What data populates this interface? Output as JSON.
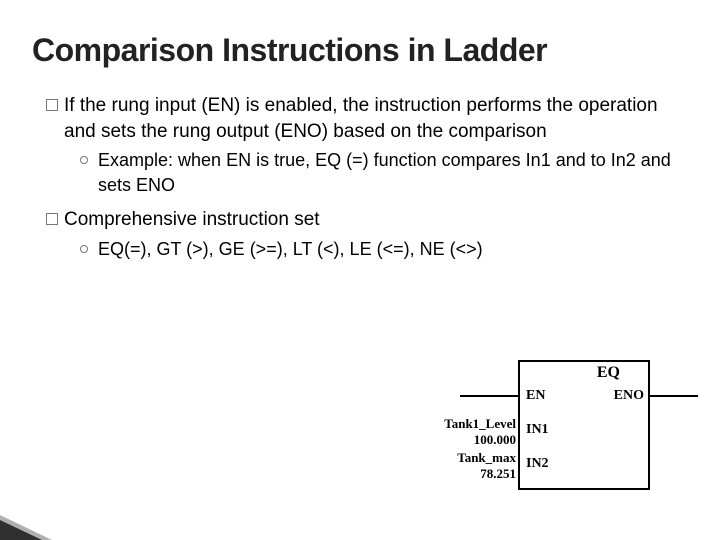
{
  "title": "Comparison Instructions in Ladder",
  "bullets": {
    "b1": "If the rung input (EN) is enabled, the instruction performs the operation and sets the rung output (ENO) based on the comparison",
    "b1a": "Example: when EN is true, EQ (=) function compares In1 and to In2 and sets ENO",
    "b2": "Comprehensive instruction set",
    "b2a": "EQ(=), GT (>), GE (>=), LT (<), LE (<=), NE (<>)"
  },
  "block": {
    "name": "EQ",
    "ports": {
      "en": "EN",
      "eno": "ENO",
      "in1": "IN1",
      "in2": "IN2"
    },
    "inputs": {
      "in1_tag": "Tank1_Level",
      "in1_val": "100.000",
      "in2_tag": "Tank_max",
      "in2_val": "78.251"
    }
  }
}
